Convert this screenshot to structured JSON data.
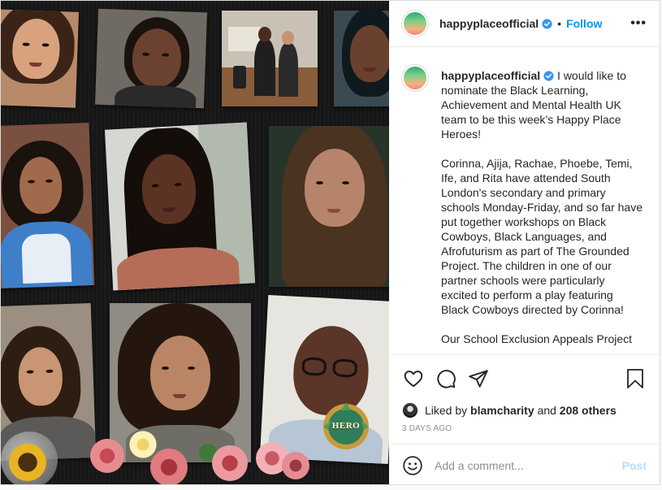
{
  "header": {
    "username": "happyplaceofficial",
    "separator": "•",
    "follow_label": "Follow",
    "more_label": "•••"
  },
  "caption": {
    "username": "happyplaceofficial",
    "paragraphs": [
      "I would like to nominate the Black Learning, Achievement and Mental Health UK team to be this week’s Happy Place Heroes!",
      "Corinna, Ajija, Rachae, Phoebe, Temi, Ife, and Rita have attended South London's secondary and primary schools Monday-Friday, and so far have put together workshops on Black Cowboys, Black Languages, and Afrofuturism as part of The Grounded Project. The children in one of our partner schools were particularly excited to perform a play featuring Black Cowboys directed by Corinna!",
      "Our School Exclusion Appeals Project"
    ]
  },
  "likes": {
    "prefix": "Liked by",
    "user": "blamcharity",
    "joiner": "and",
    "others": "208 others"
  },
  "timestamp": "3 DAYS AGO",
  "comment": {
    "placeholder": "Add a comment...",
    "post_label": "Post"
  },
  "media": {
    "badge_text": "HERO"
  },
  "icons": {
    "like": "heart-icon",
    "comment": "comment-icon",
    "share": "paper-plane-icon",
    "save": "bookmark-icon",
    "emoji": "smiley-icon",
    "verified": "verified-badge-icon",
    "more": "more-options-icon"
  },
  "colors": {
    "accent": "#0095f6",
    "post_disabled": "#b2dffc",
    "muted": "#8e8e8e",
    "text": "#262626",
    "border": "#dbdbdb"
  }
}
